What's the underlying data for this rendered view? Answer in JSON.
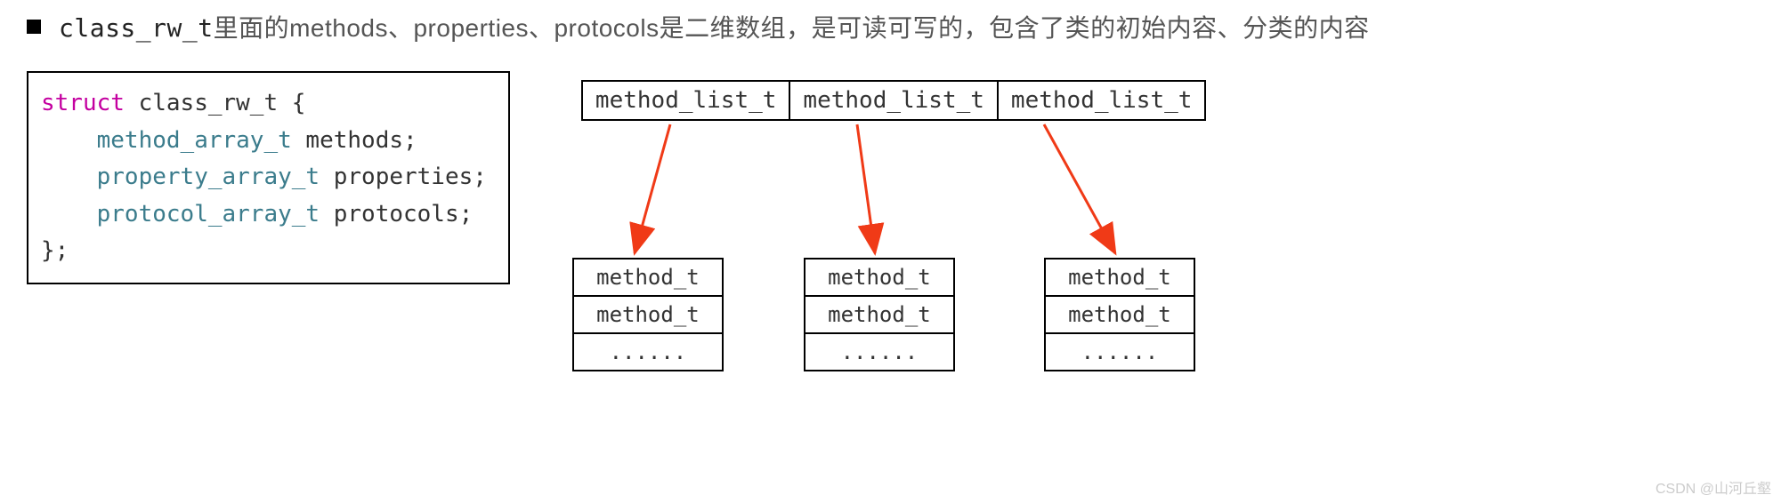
{
  "heading": {
    "code_prefix": "class_rw_t",
    "text_rest": "里面的methods、properties、protocols是二维数组，是可读可写的，包含了类的初始内容、分类的内容"
  },
  "struct": {
    "line1_kw": "struct",
    "line1_name": " class_rw_t {",
    "line2_type": "method_array_t",
    "line2_name": " methods;",
    "line3_type": "property_array_t",
    "line3_name": " properties;",
    "line4_type": "protocol_array_t",
    "line4_name": " protocols;",
    "line5": "};"
  },
  "list_cells": {
    "c0": "method_list_t",
    "c1": "method_list_t",
    "c2": "method_list_t"
  },
  "method_table": {
    "r0": "method_t",
    "r1": "method_t",
    "r2": "......"
  },
  "watermark": "CSDN @山河丘壑"
}
